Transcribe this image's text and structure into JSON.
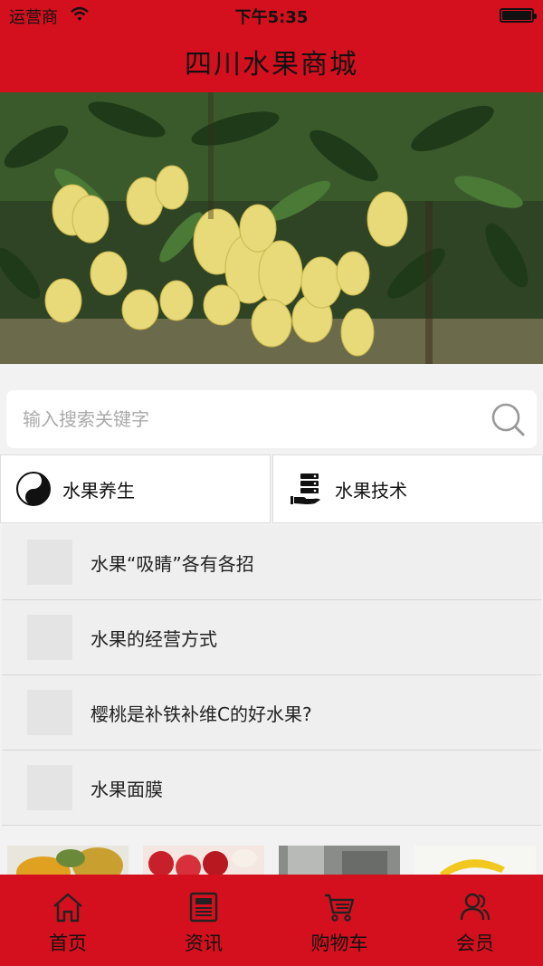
{
  "status_bar": {
    "carrier": "运营商",
    "time": "下午5:35"
  },
  "header": {
    "title": "四川水果商城"
  },
  "banner": {
    "slide_count": 3,
    "active_slide": 3
  },
  "search": {
    "placeholder": "输入搜索关键字"
  },
  "categories": [
    {
      "label": "水果养生",
      "icon": "yin-yang-icon"
    },
    {
      "label": "水果技术",
      "icon": "server-hand-icon"
    }
  ],
  "news": [
    {
      "title": "水果“吸睛”各有各招"
    },
    {
      "title": "水果的经营方式"
    },
    {
      "title": "樱桃是补铁补维C的好水果?"
    },
    {
      "title": "水果面膜"
    }
  ],
  "tabs": [
    {
      "label": "首页",
      "icon": "home-icon"
    },
    {
      "label": "资讯",
      "icon": "news-icon"
    },
    {
      "label": "购物车",
      "icon": "cart-icon"
    },
    {
      "label": "会员",
      "icon": "user-icon"
    }
  ],
  "colors": {
    "brand": "#d4101e",
    "active_dot": "#e01020"
  }
}
